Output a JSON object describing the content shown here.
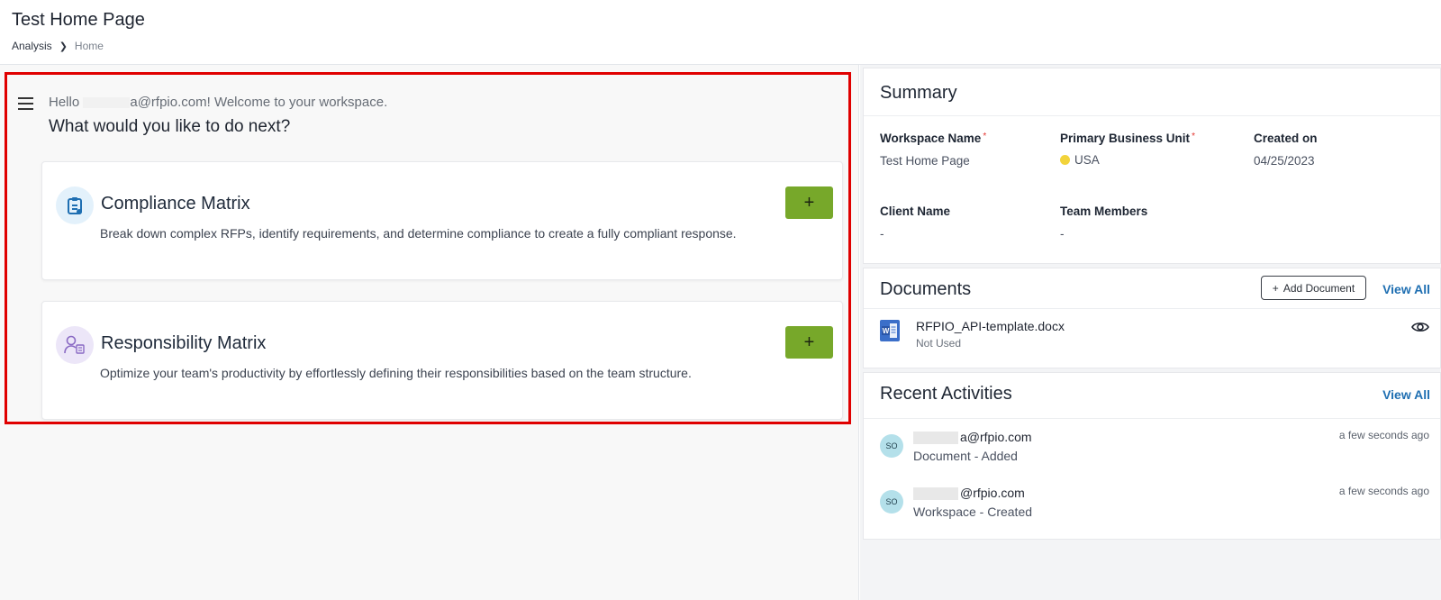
{
  "header": {
    "title": "Test Home Page",
    "breadcrumb": {
      "parent": "Analysis",
      "current": "Home"
    }
  },
  "welcome": {
    "greeting_prefix": "Hello",
    "greeting_suffix": "a@rfpio.com! Welcome to your workspace.",
    "prompt": "What would you like to do next?"
  },
  "cards": [
    {
      "title": "Compliance Matrix",
      "description": "Break down complex RFPs, identify requirements, and determine compliance to create a fully compliant response.",
      "icon": "clipboard-icon",
      "button_label": "+"
    },
    {
      "title": "Responsibility Matrix",
      "description": "Optimize your team's productivity by effortlessly defining their responsibilities based on the team structure.",
      "icon": "user-assign-icon",
      "button_label": "+"
    }
  ],
  "summary": {
    "title": "Summary",
    "fields": {
      "workspace_name": {
        "label": "Workspace Name",
        "value": "Test Home Page",
        "required": "*"
      },
      "business_unit": {
        "label": "Primary Business Unit",
        "value": "USA",
        "required": "*"
      },
      "created_on": {
        "label": "Created on",
        "value": "04/25/2023"
      },
      "client_name": {
        "label": "Client Name",
        "value": "-"
      },
      "team_members": {
        "label": "Team Members",
        "value": "-"
      }
    }
  },
  "documents": {
    "title": "Documents",
    "add_label": "Add Document",
    "add_icon": "+",
    "view_all": "View All",
    "items": [
      {
        "name": "RFPIO_API-template.docx",
        "status": "Not Used",
        "icon": "word-doc-icon"
      }
    ]
  },
  "activities": {
    "title": "Recent Activities",
    "view_all": "View All",
    "items": [
      {
        "avatar": "SO",
        "user": "a@rfpio.com",
        "action": "Document - Added",
        "time": "a few seconds ago"
      },
      {
        "avatar": "SO",
        "user": "@rfpio.com",
        "action": "Workspace - Created",
        "time": "a few seconds ago"
      }
    ]
  },
  "colors": {
    "accent_green": "#77a82a",
    "link_blue": "#1f6fb2",
    "highlight_red": "#e00000",
    "bu_dot": "#f2d33b"
  }
}
